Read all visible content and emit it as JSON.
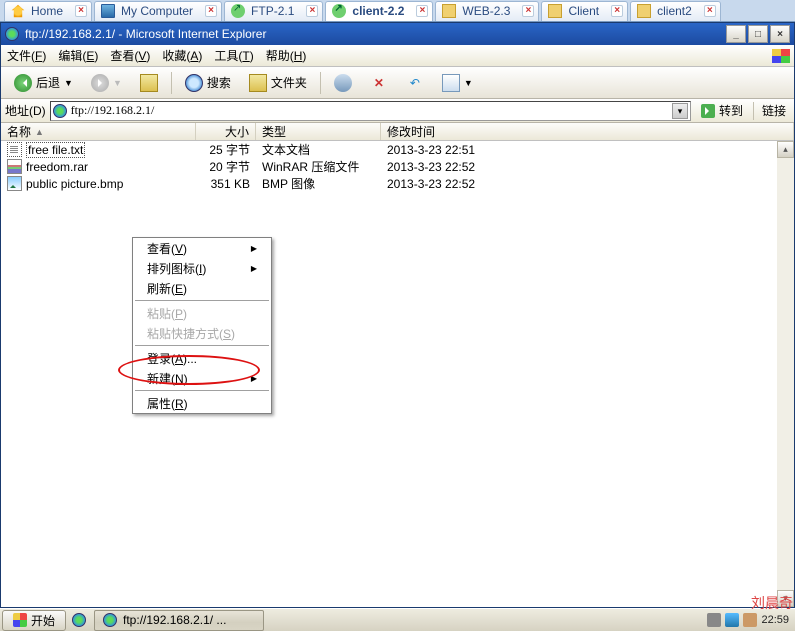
{
  "host_tabs": [
    {
      "icon": "home",
      "label": "Home"
    },
    {
      "icon": "pc",
      "label": "My Computer"
    },
    {
      "icon": "ftp",
      "label": "FTP-2.1"
    },
    {
      "icon": "ftp",
      "label": "client-2.2",
      "active": true
    },
    {
      "icon": "client",
      "label": "WEB-2.3"
    },
    {
      "icon": "client",
      "label": "Client"
    },
    {
      "icon": "client",
      "label": "client2"
    }
  ],
  "ie": {
    "title": "ftp://192.168.2.1/ - Microsoft Internet Explorer",
    "sys": {
      "min": "_",
      "max": "□",
      "close": "×"
    },
    "menu": [
      "文件(F)",
      "编辑(E)",
      "查看(V)",
      "收藏(A)",
      "工具(T)",
      "帮助(H)"
    ],
    "toolbar": {
      "back": "后退",
      "search": "搜索",
      "folders": "文件夹"
    },
    "addr_label": "地址(D)",
    "addr_value": "ftp://192.168.2.1/",
    "go": "转到",
    "links": "链接"
  },
  "columns": {
    "name": "名称",
    "size": "大小",
    "type": "类型",
    "date": "修改时间"
  },
  "files": [
    {
      "icon": "txt",
      "name": "free file.txt",
      "size": "25 字节",
      "type": "文本文档",
      "date": "2013-3-23 22:51",
      "selected": true
    },
    {
      "icon": "rar",
      "name": "freedom.rar",
      "size": "20 字节",
      "type": "WinRAR 压缩文件",
      "date": "2013-3-23 22:52"
    },
    {
      "icon": "bmp",
      "name": "public picture.bmp",
      "size": "351 KB",
      "type": "BMP 图像",
      "date": "2013-3-23 22:52"
    }
  ],
  "context_menu": [
    {
      "t": "查看(V)",
      "sub": true
    },
    {
      "t": "排列图标(I)",
      "sub": true
    },
    {
      "t": "刷新(E)"
    },
    {
      "sep": true
    },
    {
      "t": "粘贴(P)",
      "disabled": true
    },
    {
      "t": "粘贴快捷方式(S)",
      "disabled": true
    },
    {
      "sep": true
    },
    {
      "t": "登录(A)...",
      "hot": true
    },
    {
      "t": "新建(N)",
      "sub": true
    },
    {
      "sep": true
    },
    {
      "t": "属性(R)"
    }
  ],
  "taskbar": {
    "start": "开始",
    "task": "ftp://192.168.2.1/ ...",
    "clock": "22:59"
  },
  "watermark": "刘晨奇"
}
